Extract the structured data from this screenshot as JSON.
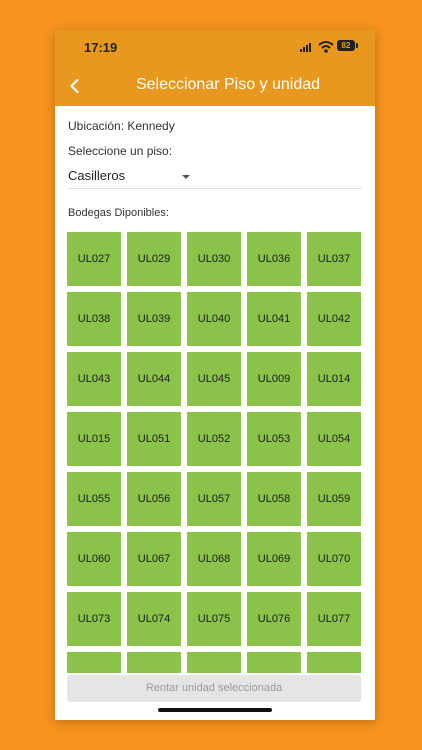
{
  "status_bar": {
    "time": "17:19",
    "battery": "82"
  },
  "appbar": {
    "title": "Seleccionar Piso y unidad"
  },
  "location_text": "Ubicación: Kennedy",
  "floor_prompt": "Seleccione un piso:",
  "floor_select": {
    "value": "Casilleros"
  },
  "units_heading": "Bodegas Diponibles:",
  "units": [
    "UL027",
    "UL029",
    "UL030",
    "UL036",
    "UL037",
    "UL038",
    "UL039",
    "UL040",
    "UL041",
    "UL042",
    "UL043",
    "UL044",
    "UL045",
    "UL009",
    "UL014",
    "UL015",
    "UL051",
    "UL052",
    "UL053",
    "UL054",
    "UL055",
    "UL056",
    "UL057",
    "UL058",
    "UL059",
    "UL060",
    "UL067",
    "UL068",
    "UL069",
    "UL070",
    "UL073",
    "UL074",
    "UL075",
    "UL076",
    "UL077",
    "",
    "",
    "",
    "",
    ""
  ],
  "rent_button": "Rentar unidad seleccionada",
  "colors": {
    "background": "#F7931E",
    "appbar": "#E8981E",
    "unit_available": "#8BC34A",
    "button_disabled": "#e5e5e5"
  },
  "icons": {
    "back": "chevron-left-icon",
    "dropdown": "caret-down-icon"
  }
}
